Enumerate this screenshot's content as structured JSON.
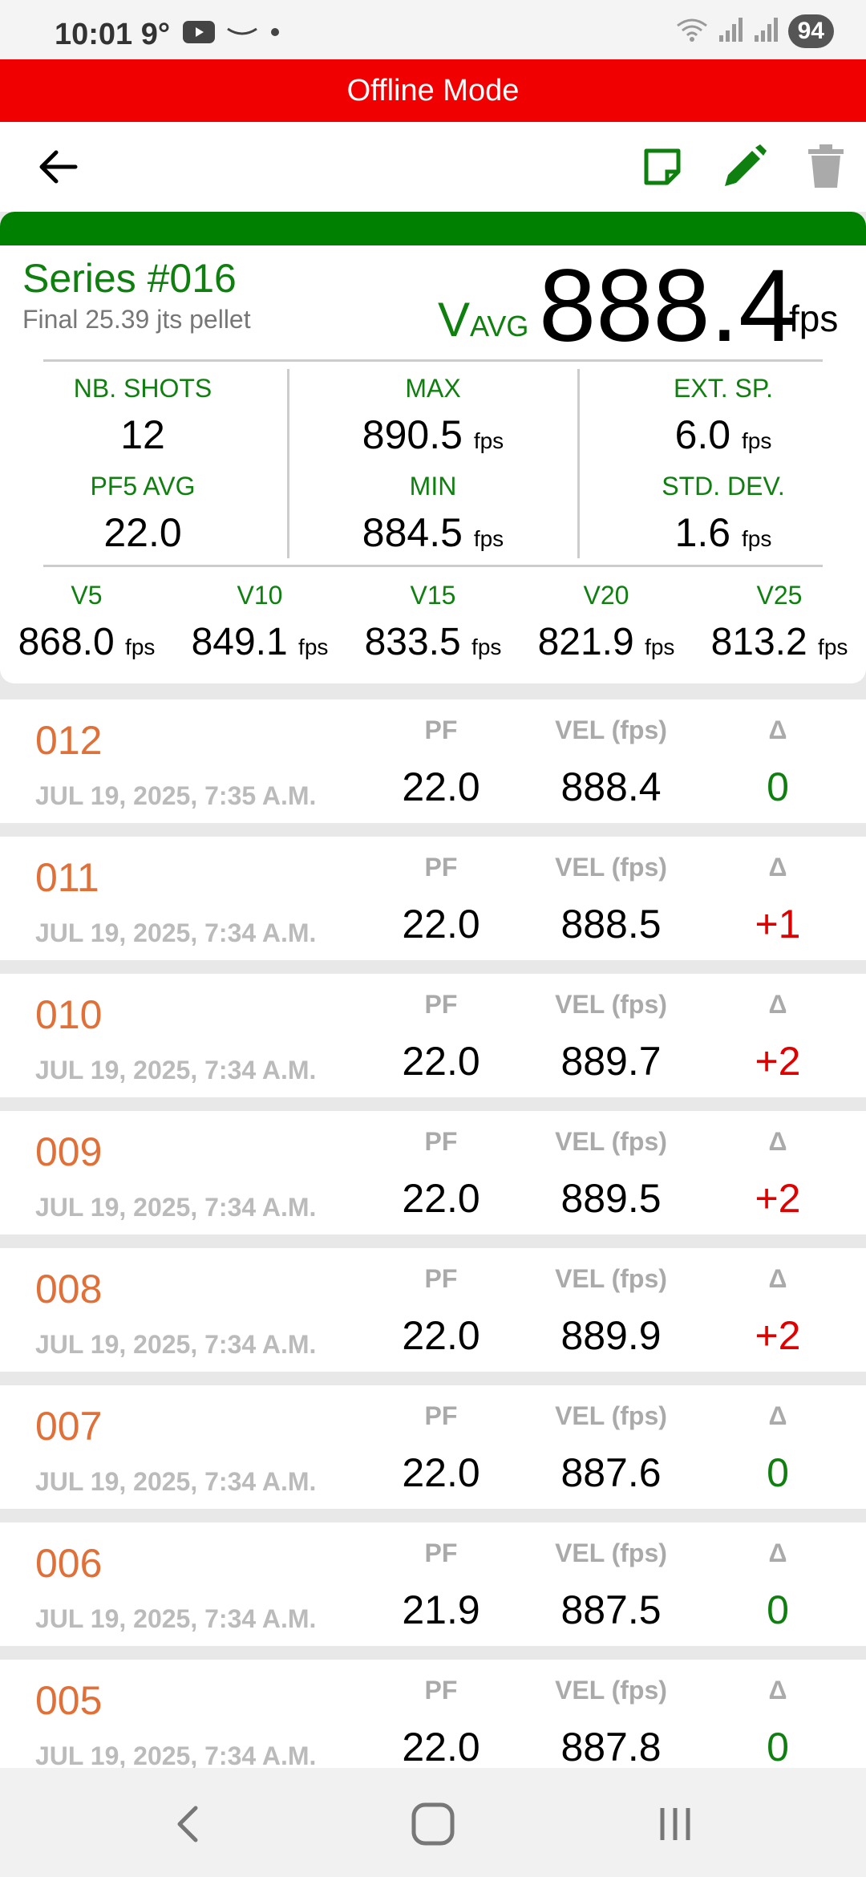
{
  "status_bar": {
    "time": "10:01",
    "temperature": "9°",
    "battery": "94",
    "icons": [
      "youtube-icon",
      "amazon-icon",
      "dot-icon",
      "wifi-icon",
      "signal-icon",
      "signal-icon"
    ]
  },
  "banner": {
    "text": "Offline Mode",
    "color": "#f00000"
  },
  "toolbar": {
    "icons": [
      "back-arrow-icon",
      "note-icon",
      "pencil-icon",
      "trash-icon"
    ]
  },
  "series": {
    "title": "Series #016",
    "subtitle": "Final 25.39 jts pellet",
    "vavg_label": "V",
    "vavg_sub": "AVG",
    "vavg_value": "888.4",
    "vavg_unit": "fps"
  },
  "stats": [
    {
      "label": "NB. SHOTS",
      "value": "12",
      "unit": ""
    },
    {
      "label": "MAX",
      "value": "890.5",
      "unit": "fps"
    },
    {
      "label": "EXT. SP.",
      "value": "6.0",
      "unit": "fps"
    },
    {
      "label": "PF5 AVG",
      "value": "22.0",
      "unit": ""
    },
    {
      "label": "MIN",
      "value": "884.5",
      "unit": "fps"
    },
    {
      "label": "STD. DEV.",
      "value": "1.6",
      "unit": "fps"
    }
  ],
  "vstats": [
    {
      "label": "V5",
      "value": "868.0",
      "unit": "fps"
    },
    {
      "label": "V10",
      "value": "849.1",
      "unit": "fps"
    },
    {
      "label": "V15",
      "value": "833.5",
      "unit": "fps"
    },
    {
      "label": "V20",
      "value": "821.9",
      "unit": "fps"
    },
    {
      "label": "V25",
      "value": "813.2",
      "unit": "fps"
    }
  ],
  "columns": {
    "pf": "PF",
    "vel": "VEL (fps)",
    "delta": "Δ"
  },
  "shots": [
    {
      "num": "012",
      "date": "JUL 19, 2025, 7:35 A.M.",
      "pf": "22.0",
      "vel": "888.4",
      "delta": "0"
    },
    {
      "num": "011",
      "date": "JUL 19, 2025, 7:34 A.M.",
      "pf": "22.0",
      "vel": "888.5",
      "delta": "+1"
    },
    {
      "num": "010",
      "date": "JUL 19, 2025, 7:34 A.M.",
      "pf": "22.0",
      "vel": "889.7",
      "delta": "+2"
    },
    {
      "num": "009",
      "date": "JUL 19, 2025, 7:34 A.M.",
      "pf": "22.0",
      "vel": "889.5",
      "delta": "+2"
    },
    {
      "num": "008",
      "date": "JUL 19, 2025, 7:34 A.M.",
      "pf": "22.0",
      "vel": "889.9",
      "delta": "+2"
    },
    {
      "num": "007",
      "date": "JUL 19, 2025, 7:34 A.M.",
      "pf": "22.0",
      "vel": "887.6",
      "delta": "0"
    },
    {
      "num": "006",
      "date": "JUL 19, 2025, 7:34 A.M.",
      "pf": "21.9",
      "vel": "887.5",
      "delta": "0"
    },
    {
      "num": "005",
      "date": "JUL 19, 2025, 7:34 A.M.",
      "pf": "22.0",
      "vel": "887.8",
      "delta": "0"
    }
  ],
  "colors": {
    "green": "#0f7f0f",
    "orange": "#e07038",
    "red": "#e00000",
    "grey": "#aaaaaa"
  },
  "nav": {
    "icons": [
      "back-nav-icon",
      "home-nav-icon",
      "recents-nav-icon"
    ]
  }
}
